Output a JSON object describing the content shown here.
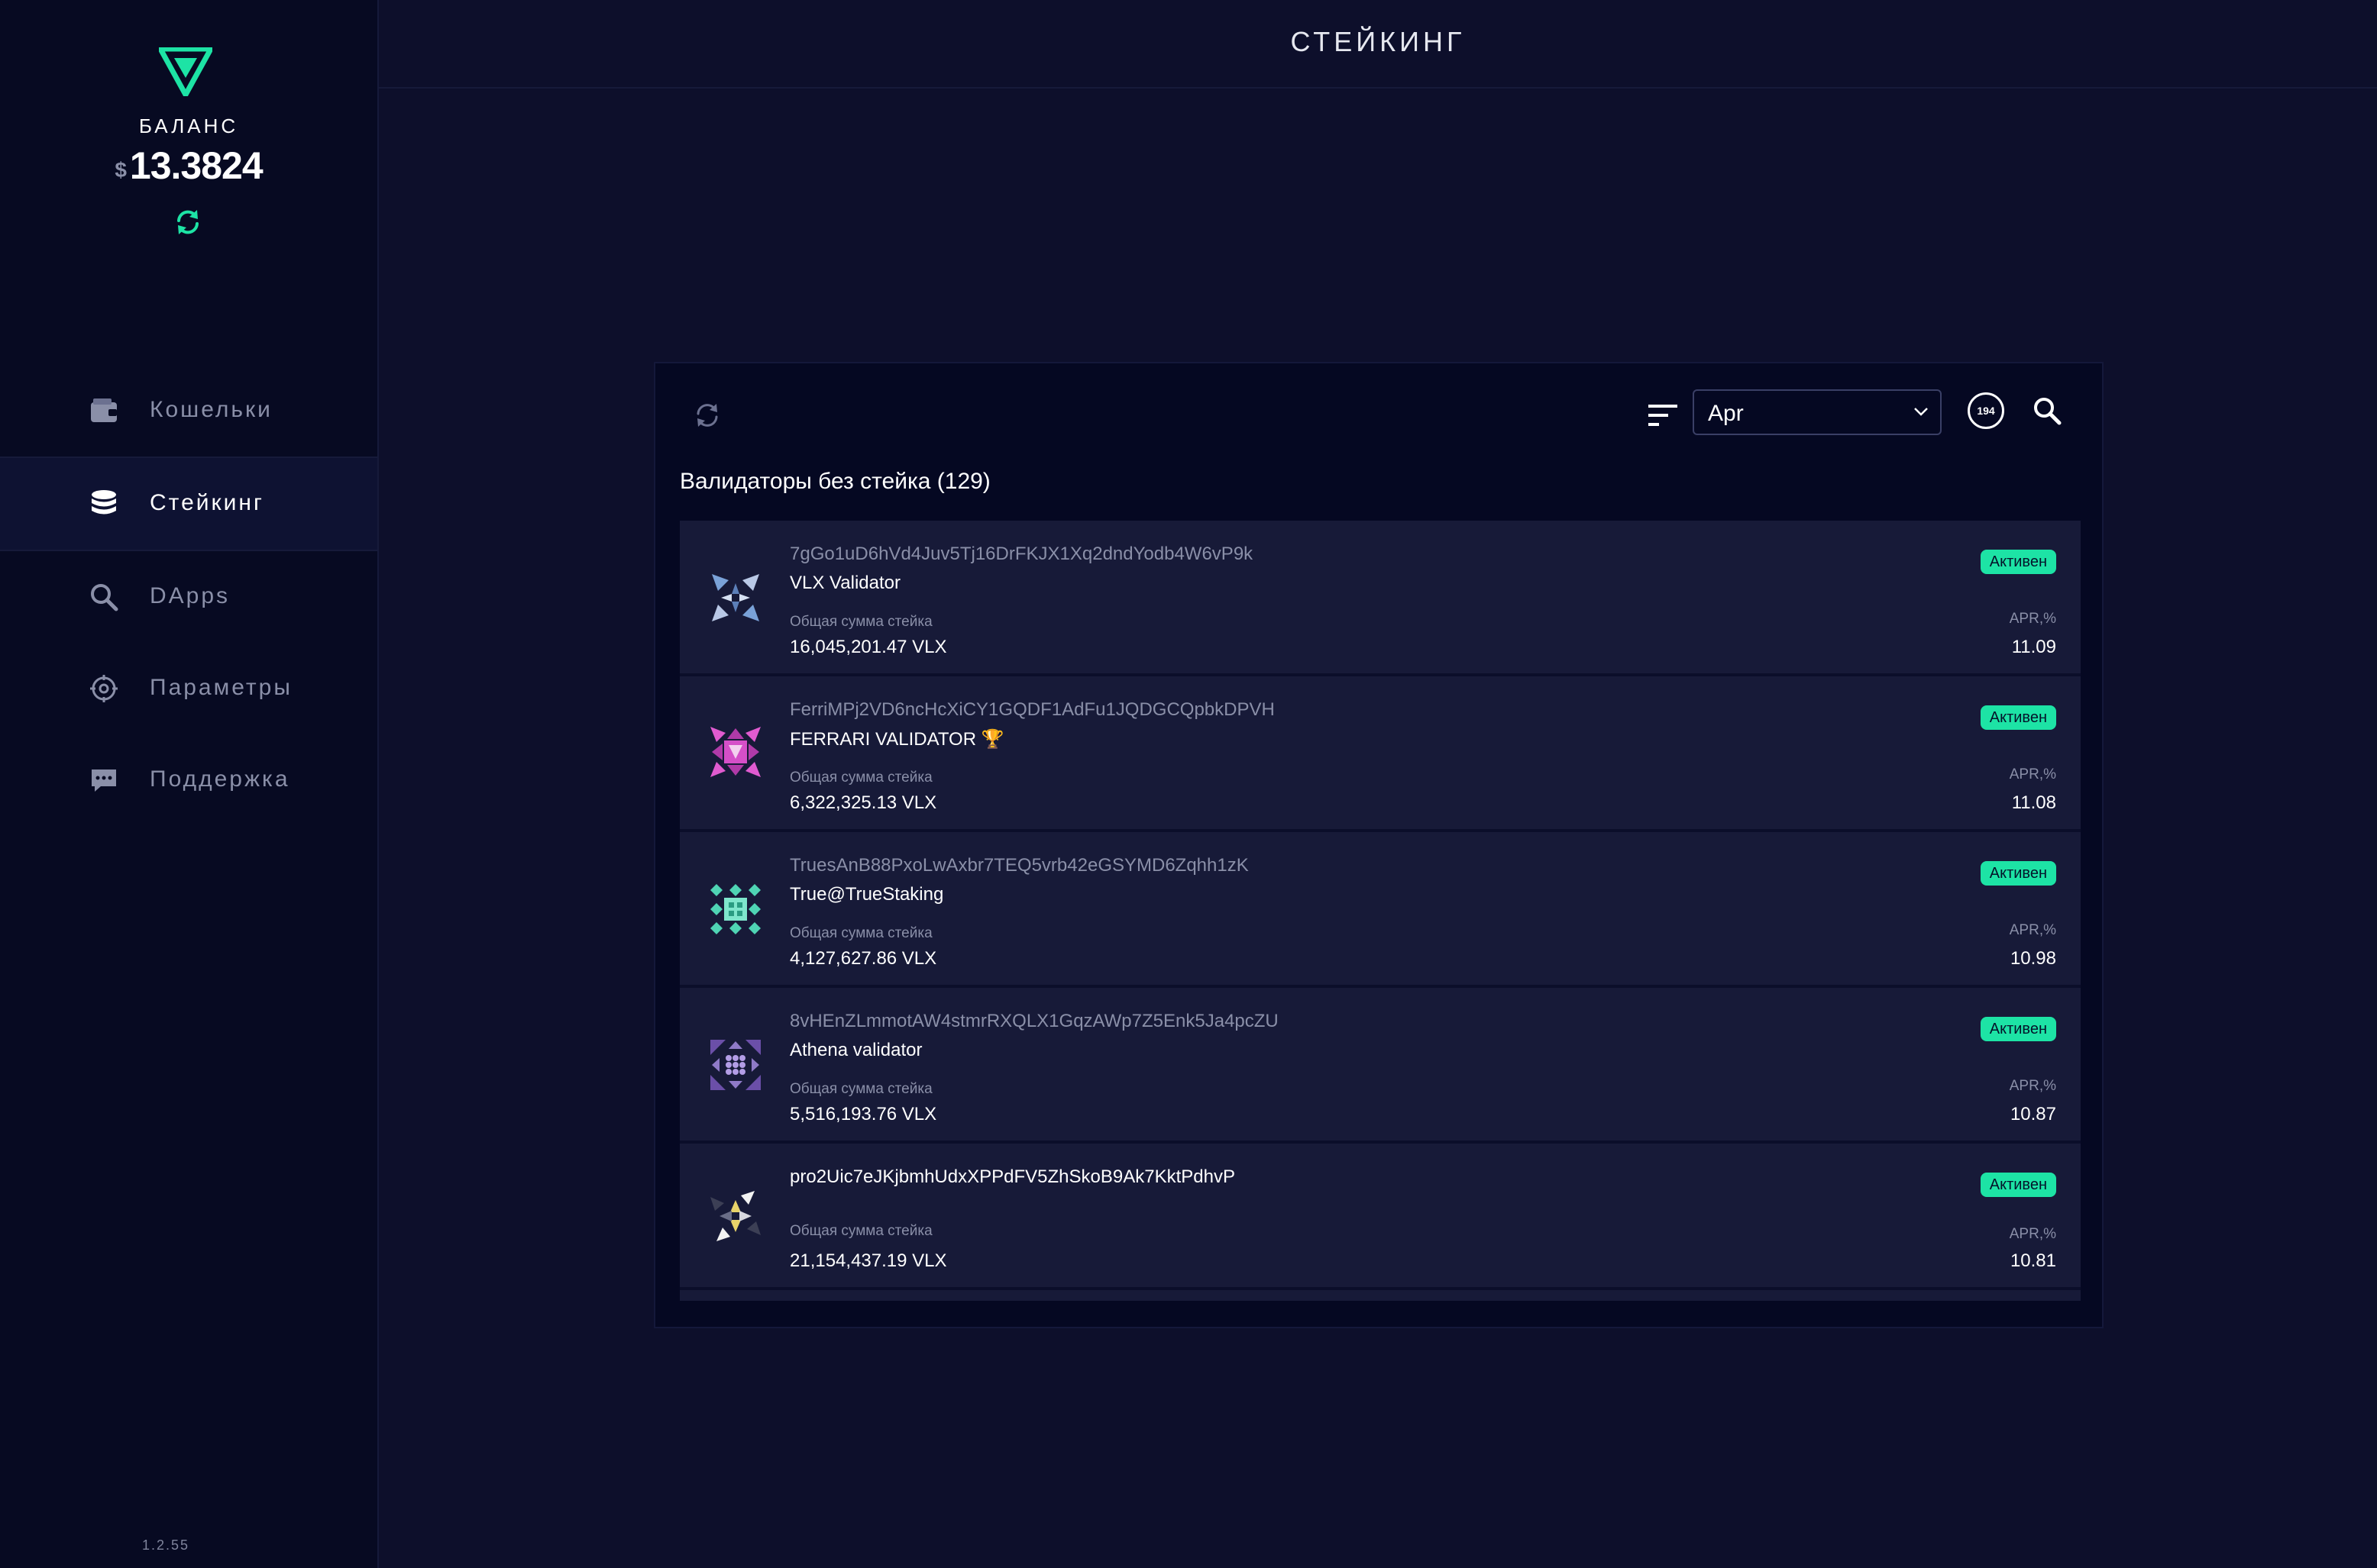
{
  "sidebar": {
    "balance_label": "БАЛАНС",
    "currency": "$",
    "balance": "13.3824",
    "items": [
      {
        "label": "Кошельки",
        "icon": "wallet-icon"
      },
      {
        "label": "Стейкинг",
        "icon": "coins-stack-icon",
        "active": true
      },
      {
        "label": "DApps",
        "icon": "search-icon"
      },
      {
        "label": "Параметры",
        "icon": "gear-icon"
      },
      {
        "label": "Поддержка",
        "icon": "chat-bubble-icon"
      }
    ],
    "version": "1.2.55"
  },
  "header": {
    "title": "СТЕЙКИНГ"
  },
  "toolbar": {
    "sort_selected": "Apr",
    "count": "194"
  },
  "list": {
    "title": "Валидаторы без стейка (129)",
    "stake_label": "Общая сумма стейка",
    "apr_label": "APR,%",
    "rows": [
      {
        "address": "7gGo1uD6hVd4Juv5Tj16DrFKJX1Xq2dndYodb4W6vP9k",
        "name": "VLX Validator",
        "stake": "16,045,201.47 VLX",
        "status": "Активен",
        "apr": "11.09"
      },
      {
        "address": "FerriMPj2VD6ncHcXiCY1GQDF1AdFu1JQDGCQpbkDPVH",
        "name": "FERRARI VALIDATOR 🏆",
        "stake": "6,322,325.13 VLX",
        "status": "Активен",
        "apr": "11.08"
      },
      {
        "address": "TruesAnB88PxoLwAxbr7TEQ5vrb42eGSYMD6Zqhh1zK",
        "name": "True@TrueStaking",
        "stake": "4,127,627.86 VLX",
        "status": "Активен",
        "apr": "10.98"
      },
      {
        "address": "8vHEnZLmmotAW4stmrRXQLX1GqzAWp7Z5Enk5Ja4pcZU",
        "name": "Athena validator",
        "stake": "5,516,193.76 VLX",
        "status": "Активен",
        "apr": "10.87"
      },
      {
        "address": "pro2Uic7eJKjbmhUdxXPPdFV5ZhSkoB9Ak7KktPdhvP",
        "name": "",
        "stake": "21,154,437.19 VLX",
        "status": "Активен",
        "apr": "10.81"
      }
    ]
  },
  "colors": {
    "accent": "#1de3a5",
    "sidebar_bg": "#070a22",
    "page_bg": "#0d0f2b",
    "row_bg": "#171a38"
  }
}
